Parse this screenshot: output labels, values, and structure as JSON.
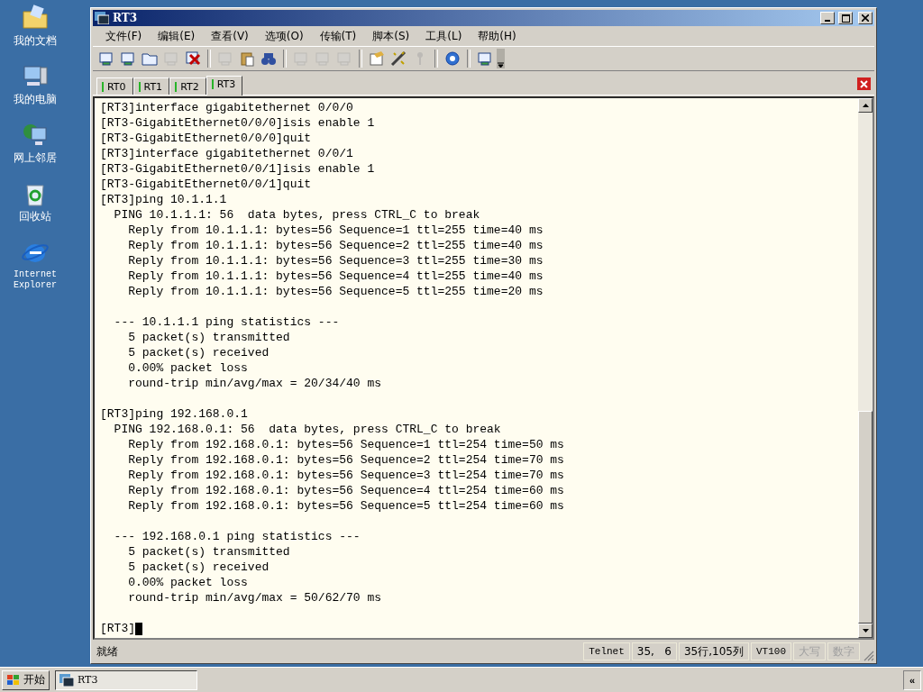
{
  "desktop_icons": [
    {
      "label": "我的文档"
    },
    {
      "label": "我的电脑"
    },
    {
      "label": "网上邻居"
    },
    {
      "label": "回收站"
    },
    {
      "label": "Internet Explorer"
    }
  ],
  "window": {
    "title": "RT3"
  },
  "menu": [
    {
      "label": "文件(F)"
    },
    {
      "label": "编辑(E)"
    },
    {
      "label": "查看(V)"
    },
    {
      "label": "选项(O)"
    },
    {
      "label": "传输(T)"
    },
    {
      "label": "脚本(S)"
    },
    {
      "label": "工具(L)"
    },
    {
      "label": "帮助(H)"
    }
  ],
  "toolbar_groups": [
    [
      {
        "disabled": false
      },
      {
        "disabled": false
      },
      {
        "disabled": false
      },
      {
        "disabled": true
      },
      {
        "disabled": false
      }
    ],
    [
      {
        "disabled": true
      },
      {
        "disabled": false
      },
      {
        "disabled": false
      }
    ],
    [
      {
        "disabled": true
      },
      {
        "disabled": true
      },
      {
        "disabled": true
      }
    ],
    [
      {
        "disabled": false
      },
      {
        "disabled": false
      },
      {
        "disabled": true
      }
    ],
    [
      {
        "disabled": false
      }
    ],
    [
      {
        "disabled": false
      }
    ]
  ],
  "tabs": [
    {
      "label": "RT0",
      "selected": false
    },
    {
      "label": "RT1",
      "selected": false
    },
    {
      "label": "RT2",
      "selected": false
    },
    {
      "label": "RT3",
      "selected": true
    }
  ],
  "terminal_blocks": [
    [
      "[RT3]interface gigabitethernet 0/0/0",
      "[RT3-GigabitEthernet0/0/0]isis enable 1",
      "[RT3-GigabitEthernet0/0/0]quit",
      "[RT3]interface gigabitethernet 0/0/1",
      "[RT3-GigabitEthernet0/0/1]isis enable 1",
      "[RT3-GigabitEthernet0/0/1]quit",
      "[RT3]ping 10.1.1.1",
      "  PING 10.1.1.1: 56  data bytes, press CTRL_C to break",
      "    Reply from 10.1.1.1: bytes=56 Sequence=1 ttl=255 time=40 ms",
      "    Reply from 10.1.1.1: bytes=56 Sequence=2 ttl=255 time=40 ms",
      "    Reply from 10.1.1.1: bytes=56 Sequence=3 ttl=255 time=30 ms",
      "    Reply from 10.1.1.1: bytes=56 Sequence=4 ttl=255 time=40 ms",
      "    Reply from 10.1.1.1: bytes=56 Sequence=5 ttl=255 time=20 ms"
    ],
    [
      "  --- 10.1.1.1 ping statistics ---",
      "    5 packet(s) transmitted",
      "    5 packet(s) received",
      "    0.00% packet loss",
      "    round-trip min/avg/max = 20/34/40 ms"
    ],
    [
      "[RT3]ping 192.168.0.1",
      "  PING 192.168.0.1: 56  data bytes, press CTRL_C to break",
      "    Reply from 192.168.0.1: bytes=56 Sequence=1 ttl=254 time=50 ms",
      "    Reply from 192.168.0.1: bytes=56 Sequence=2 ttl=254 time=70 ms",
      "    Reply from 192.168.0.1: bytes=56 Sequence=3 ttl=254 time=70 ms",
      "    Reply from 192.168.0.1: bytes=56 Sequence=4 ttl=254 time=60 ms",
      "    Reply from 192.168.0.1: bytes=56 Sequence=5 ttl=254 time=60 ms"
    ],
    [
      "  --- 192.168.0.1 ping statistics ---",
      "    5 packet(s) transmitted",
      "    5 packet(s) received",
      "    0.00% packet loss",
      "    round-trip min/avg/max = 50/62/70 ms"
    ],
    [
      "[RT3]"
    ]
  ],
  "status_bar": {
    "message": "就绪",
    "panes": [
      {
        "text": "Telnet",
        "disabled": false
      },
      {
        "text": "35,   6",
        "disabled": false
      },
      {
        "text": "35行,105列",
        "disabled": false
      },
      {
        "text": "VT100",
        "disabled": false
      },
      {
        "text": "大写",
        "disabled": true
      },
      {
        "text": "数字",
        "disabled": true
      }
    ]
  },
  "taskbar": {
    "start": "开始",
    "tasks": [
      {
        "label": "RT3"
      }
    ],
    "tray_button": "«"
  }
}
